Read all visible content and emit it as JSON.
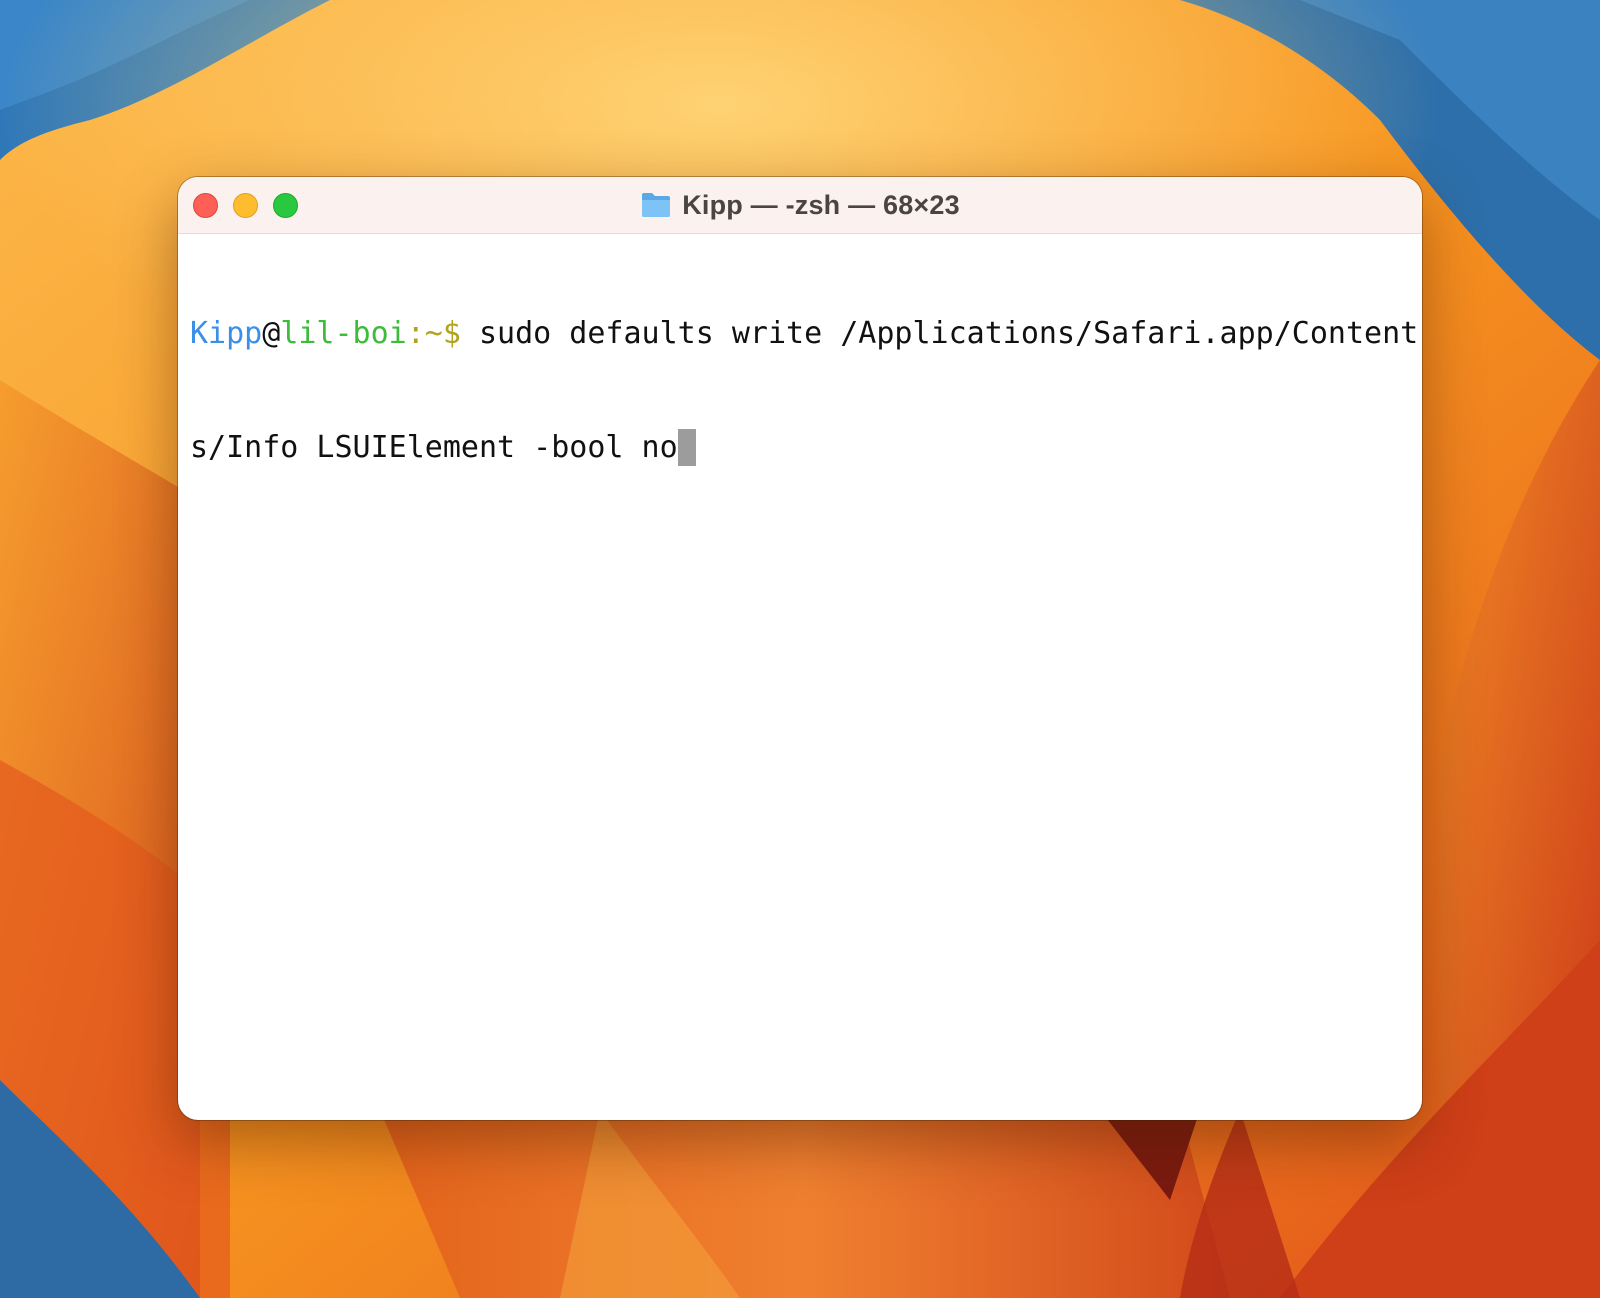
{
  "window": {
    "title": "Kipp — -zsh — 68×23"
  },
  "terminal": {
    "prompt": {
      "user": "Kipp",
      "at": "@",
      "host": "lil-boi",
      "path_sep": ":~$"
    },
    "command_line_1": " sudo defaults write /Applications/Safari.app/Content",
    "command_line_2": "s/Info LSUIElement -bool no"
  },
  "colors": {
    "user": "#3a8fe8",
    "host": "#3dbb3a",
    "path": "#b2a31f",
    "cursor": "#9c9c9c"
  },
  "icons": {
    "title": "folder-icon"
  }
}
